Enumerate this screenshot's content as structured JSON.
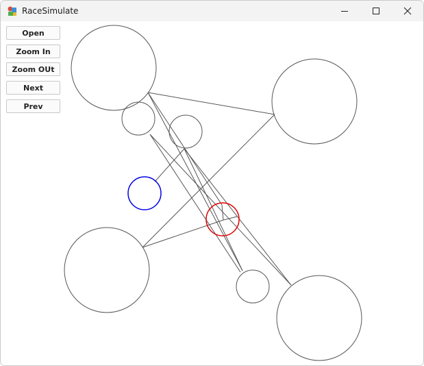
{
  "window": {
    "title": "RaceSimulate"
  },
  "toolbar": {
    "open_label": "Open",
    "zoom_in_label": "Zoom In",
    "zoom_out_label": "Zoom OUt",
    "next_label": "Next",
    "prev_label": "Prev"
  },
  "drawing": {
    "colors": {
      "default_stroke": "#555555",
      "highlight_blue": "#0000e6",
      "highlight_red": "#e00000"
    }
  }
}
